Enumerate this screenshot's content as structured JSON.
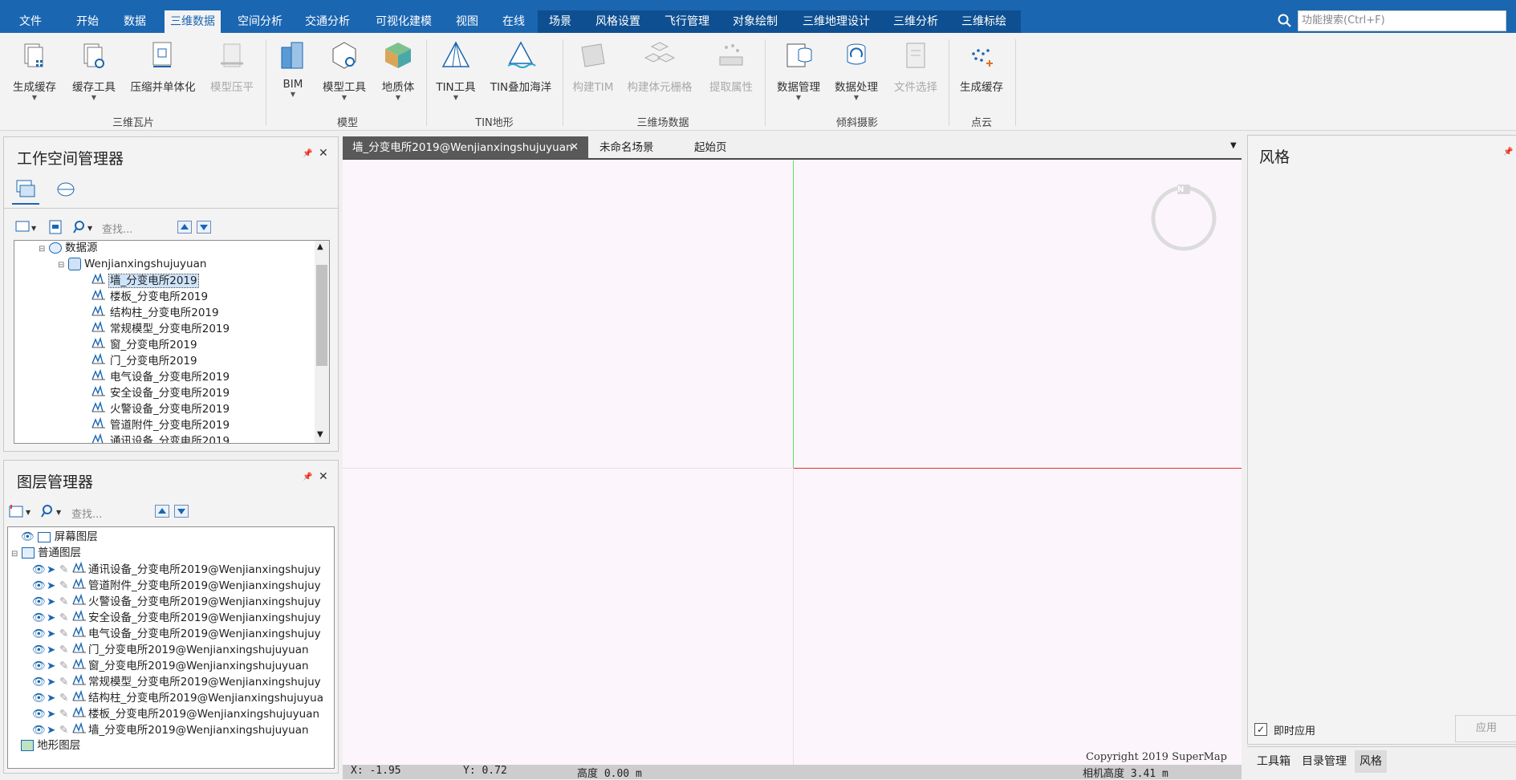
{
  "menubar": {
    "items": [
      "文件",
      "开始",
      "数据",
      "三维数据",
      "空间分析",
      "交通分析",
      "可视化建模",
      "视图",
      "在线",
      "场景",
      "风格设置",
      "飞行管理",
      "对象绘制",
      "三维地理设计",
      "三维分析",
      "三维标绘"
    ],
    "search_placeholder": "功能搜索(Ctrl+F)",
    "accent": "#1b66b1"
  },
  "ribbon": {
    "buttons": [
      "生成缓存",
      "缓存工具",
      "压缩并单体化",
      "模型压平",
      "BIM",
      "模型工具",
      "地质体",
      "TIN工具",
      "TIN叠加海洋",
      "构建TIM",
      "构建体元栅格",
      "提取属性",
      "数据管理",
      "数据处理",
      "文件选择",
      "生成缓存"
    ],
    "groups": [
      "三维瓦片",
      "模型",
      "TIN地形",
      "三维场数据",
      "倾斜摄影",
      "点云"
    ]
  },
  "workspace": {
    "title": "工作空间管理器",
    "search_placeholder": "查找...",
    "tree": {
      "root": "数据源",
      "datasource": "Wenjianxingshujuyuan",
      "datasets": [
        "墙_分变电所2019",
        "楼板_分变电所2019",
        "结构柱_分变电所2019",
        "常规模型_分变电所2019",
        "窗_分变电所2019",
        "门_分变电所2019",
        "电气设备_分变电所2019",
        "安全设备_分变电所2019",
        "火警设备_分变电所2019",
        "管道附件_分变电所2019",
        "通讯设备_分变电所2019"
      ],
      "selected": "墙_分变电所2019"
    }
  },
  "layers": {
    "title": "图层管理器",
    "search_placeholder": "查找...",
    "screen_layer": "屏幕图层",
    "normal_layer": "普通图层",
    "items": [
      "通讯设备_分变电所2019@Wenjianxingshujuy",
      "管道附件_分变电所2019@Wenjianxingshujuy",
      "火警设备_分变电所2019@Wenjianxingshujuy",
      "安全设备_分变电所2019@Wenjianxingshujuy",
      "电气设备_分变电所2019@Wenjianxingshujuy",
      "门_分变电所2019@Wenjianxingshujuyuan",
      "窗_分变电所2019@Wenjianxingshujuyuan",
      "常规模型_分变电所2019@Wenjianxingshujuy",
      "结构柱_分变电所2019@Wenjianxingshujuyua",
      "楼板_分变电所2019@Wenjianxingshujuyuan",
      "墙_分变电所2019@Wenjianxingshujuyuan"
    ],
    "terrain_layer": "地形图层"
  },
  "tabs": [
    "墙_分变电所2019@Wenjianxingshujuyuan",
    "未命名场景",
    "起始页"
  ],
  "viewport": {
    "compass_label": "N",
    "copyright": "Copyright 2019 SuperMap"
  },
  "status": {
    "x": "X: -1.95",
    "y": "Y: 0.72",
    "height": "高度 0.00 m",
    "camera": "相机高度 3.41 m"
  },
  "style_panel": {
    "title": "风格",
    "instant_apply": "即时应用",
    "apply": "应用",
    "bottom_tabs": [
      "工具箱",
      "目录管理",
      "风格"
    ]
  }
}
